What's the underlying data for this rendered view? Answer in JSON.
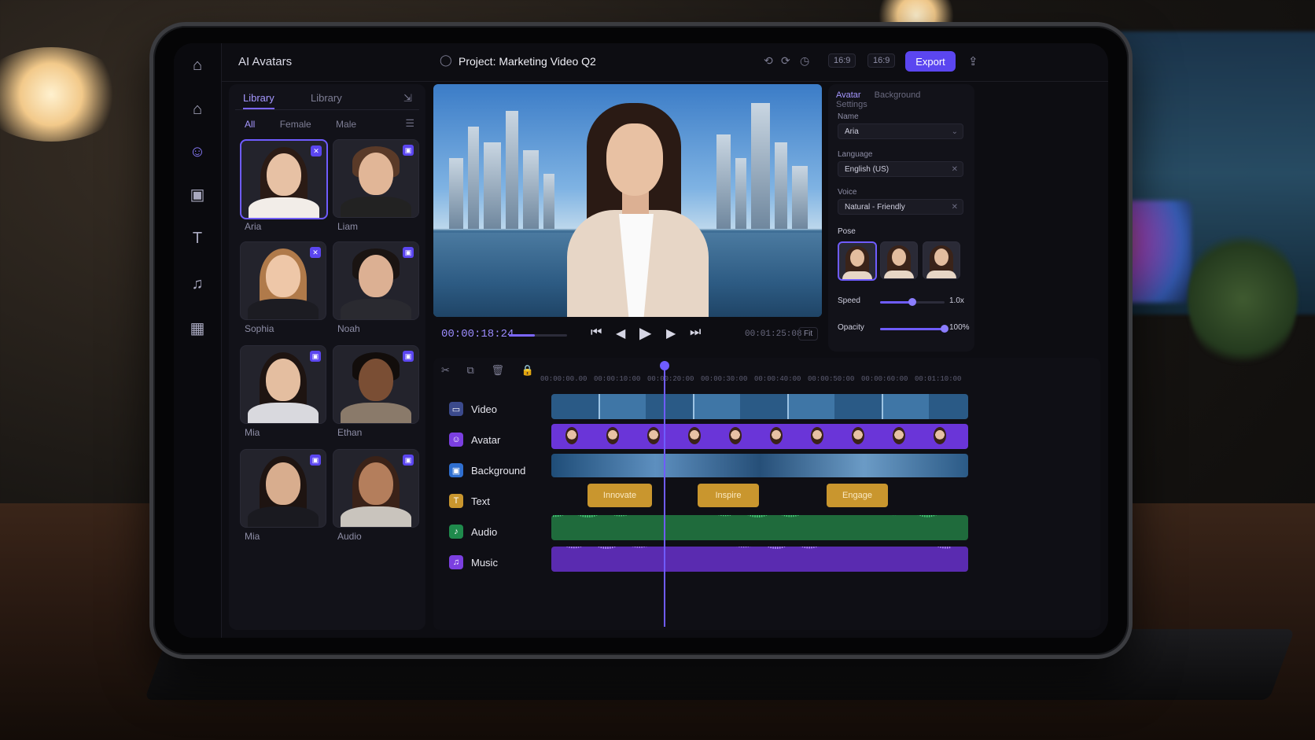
{
  "topbar": {
    "app_title": "AI Avatars",
    "project_label": "Project:",
    "project_name": "Marketing Video Q2",
    "ratio_a": "16:9",
    "ratio_b": "16:9",
    "export_label": "Export"
  },
  "library": {
    "tabs": [
      "Library",
      "Library"
    ],
    "filters": [
      "All",
      "Female",
      "Male"
    ],
    "avatars": [
      {
        "name": "Aria"
      },
      {
        "name": "Liam"
      },
      {
        "name": "Sophia"
      },
      {
        "name": "Noah"
      },
      {
        "name": "Mia"
      },
      {
        "name": "Ethan"
      },
      {
        "name": "Mia"
      },
      {
        "name": "Audio"
      }
    ]
  },
  "player": {
    "current_time": "00:00:18:24",
    "duration": "00:01:25:08",
    "fit_label": "Fit",
    "progress": 0.45
  },
  "properties": {
    "tabs": [
      "Avatar",
      "Background",
      "Settings"
    ],
    "name_label": "Name",
    "name_value": "Aria",
    "language_label": "Language",
    "language_value": "English (US)",
    "voice_label": "Voice",
    "voice_value": "Natural - Friendly",
    "pose_label": "Pose",
    "speed_label": "Speed",
    "speed_value": "1.0x",
    "speed_level": 0.5,
    "opacity_label": "Opacity",
    "opacity_value": "100%",
    "opacity_level": 1.0
  },
  "timeline": {
    "ruler": [
      "00:00:00.00",
      "00:00:10:00",
      "00:00:20:00",
      "00:00:30:00",
      "00:00:40:00",
      "00:00:50:00",
      "00:00:60:00",
      "00:01:10:00"
    ],
    "tracks": [
      {
        "label": "Video",
        "color": "#3b4a8c"
      },
      {
        "label": "Avatar",
        "color": "#7b3fe0"
      },
      {
        "label": "Background",
        "color": "#2f6fd0"
      },
      {
        "label": "Text",
        "color": "#c9962e"
      },
      {
        "label": "Audio",
        "color": "#1f8a4c"
      },
      {
        "label": "Music",
        "color": "#7b3fe0"
      }
    ],
    "text_clips": [
      "Innovate",
      "Inspire",
      "Engage"
    ]
  },
  "icons": {
    "rail": [
      "home-icon",
      "avatar-icon",
      "media-icon",
      "text-icon",
      "music-icon",
      "apps-icon"
    ]
  }
}
